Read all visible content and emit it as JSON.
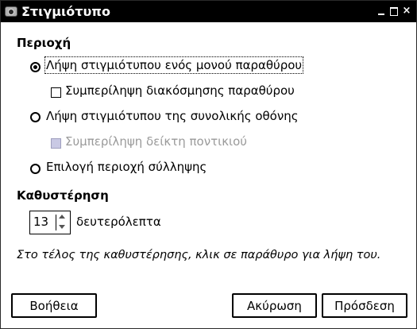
{
  "window": {
    "title": "Στιγμιότυπο",
    "controls": {
      "minimize": "minimize",
      "maximize": "maximize",
      "close": "×"
    }
  },
  "area": {
    "title": "Περιοχή",
    "options": [
      {
        "label": "Λήψη στιγμιότυπου ενός μονού παραθύρου",
        "selected": true
      },
      {
        "label": "Λήψη στιγμιότυπου της συνολικής οθόνης",
        "selected": false
      },
      {
        "label": "Επιλογή περιοχή σύλληψης",
        "selected": false
      }
    ],
    "checks": [
      {
        "label": "Συμπερίληψη διακόσμησης παραθύρου",
        "checked": false,
        "enabled": true
      },
      {
        "label": "Συμπερίληψη δείκτη ποντικιού",
        "checked": false,
        "enabled": false
      }
    ]
  },
  "delay": {
    "title": "Καθυστέρηση",
    "value": "13",
    "unit": "δευτερόλεπτα"
  },
  "info": "Στο τέλος της καθυστέρησης, κλικ σε παράθυρο για λήψη του.",
  "buttons": {
    "help": "Βοήθεια",
    "cancel": "Ακύρωση",
    "ok": "Πρόσδεση"
  }
}
